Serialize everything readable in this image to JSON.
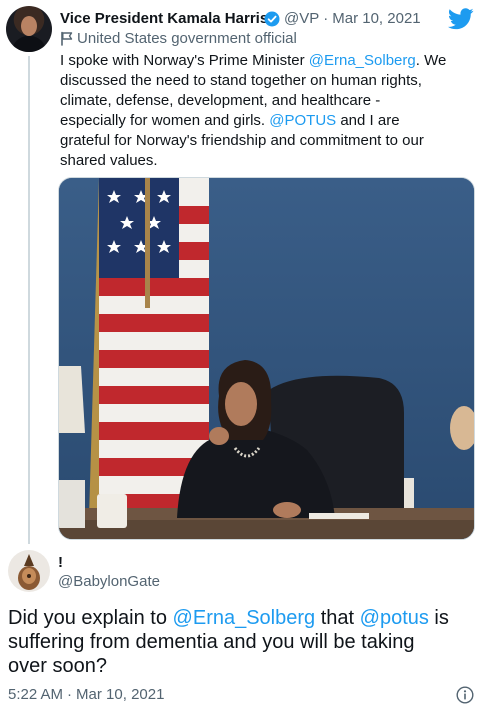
{
  "tweet": {
    "author_name": "Vice President Kamala Harris",
    "handle": "@VP",
    "separator": "·",
    "date": "Mar 10, 2021",
    "gov_label": "United States government official",
    "text_lines": [
      [
        {
          "t": "I spoke with Norway's Prime Minister "
        },
        {
          "t": "@Erna_Solberg",
          "link": true
        },
        {
          "t": ". We"
        }
      ],
      [
        {
          "t": "discussed the need to stand together on human rights,"
        }
      ],
      [
        {
          "t": "climate, defense, development, and healthcare -"
        }
      ],
      [
        {
          "t": "especially for women and girls. "
        },
        {
          "t": "@POTUS",
          "link": true
        },
        {
          "t": " and I are"
        }
      ],
      [
        {
          "t": "grateful for Norway's friendship and commitment to our"
        }
      ],
      [
        {
          "t": "shared values."
        }
      ]
    ]
  },
  "reply": {
    "author_name": "!",
    "handle": "@BabylonGate",
    "text_lines": [
      [
        {
          "t": "Did you explain to "
        },
        {
          "t": "@Erna_Solberg",
          "link": true
        },
        {
          "t": " that "
        },
        {
          "t": "@potus",
          "link": true
        },
        {
          "t": " is"
        }
      ],
      [
        {
          "t": "suffering from dementia and you will be taking"
        }
      ],
      [
        {
          "t": "over soon?"
        }
      ]
    ],
    "time": "5:22 AM",
    "separator": "·",
    "date": "Mar 10, 2021"
  },
  "icons": {
    "verified": "verified-badge-icon",
    "twitter": "twitter-bird-icon",
    "gov": "flag-icon",
    "info": "info-icon"
  },
  "colors": {
    "accent": "#1d9bf0",
    "text": "#0f1419",
    "muted": "#536471"
  }
}
